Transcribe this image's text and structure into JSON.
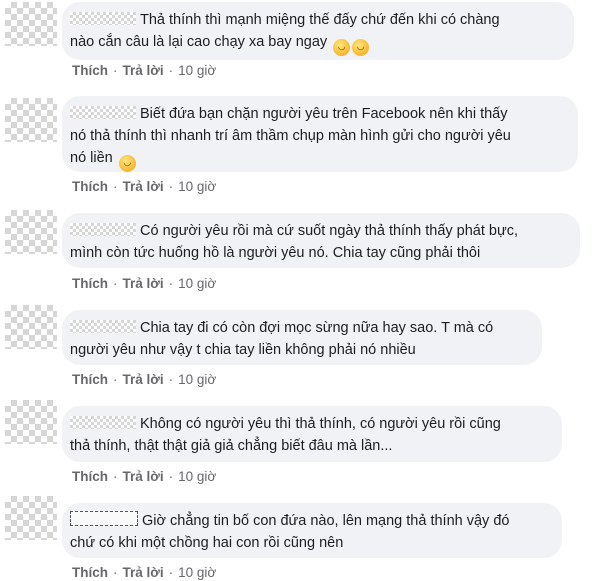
{
  "comments": [
    {
      "lines": [
        "Thả thính thì mạnh miệng thế đấy chứ đến khi có chàng",
        "nào cắn câu là lại cao chạy xa bay ngay"
      ],
      "emojis": [
        "rolling-on-floor-laughing-emoji",
        "rolling-on-floor-laughing-emoji"
      ],
      "like": "Thích",
      "reply": "Trả lời",
      "time": "10 giờ"
    },
    {
      "lines": [
        "Biết đứa bạn chặn người yêu trên Facebook nên khi thấy",
        "nó thả thính thì nhanh trí âm thầm chụp màn hình gửi cho người yêu",
        "nó liền"
      ],
      "emojis": [
        "grinning-squinting-emoji"
      ],
      "like": "Thích",
      "reply": "Trả lời",
      "time": "10 giờ"
    },
    {
      "lines": [
        "Có người yêu rồi mà cứ suốt ngày thả thính thấy phát bực,",
        "mình còn tức huống hồ là người yêu nó. Chia tay cũng phải thôi"
      ],
      "like": "Thích",
      "reply": "Trả lời",
      "time": "10 giờ"
    },
    {
      "lines": [
        "Chia tay đi có còn đợi mọc sừng nữa hay sao. T mà có",
        "người yêu như vậy t chia tay liền không phải nó nhiều"
      ],
      "like": "Thích",
      "reply": "Trả lời",
      "time": "10 giờ"
    },
    {
      "lines": [
        "Không có người yêu thì thả thính, có người yêu rồi cũng",
        "thả thính, thật thật giả giả chẳng biết đâu mà lần..."
      ],
      "like": "Thích",
      "reply": "Trả lời",
      "time": "10 giờ"
    },
    {
      "lines": [
        "Giờ chẳng tin bố con đứa nào, lên mạng thả thính vậy đó",
        "chứ có khi một chồng hai con rồi cũng nên"
      ],
      "like": "Thích",
      "reply": "Trả lời",
      "time": "10 giờ"
    }
  ]
}
